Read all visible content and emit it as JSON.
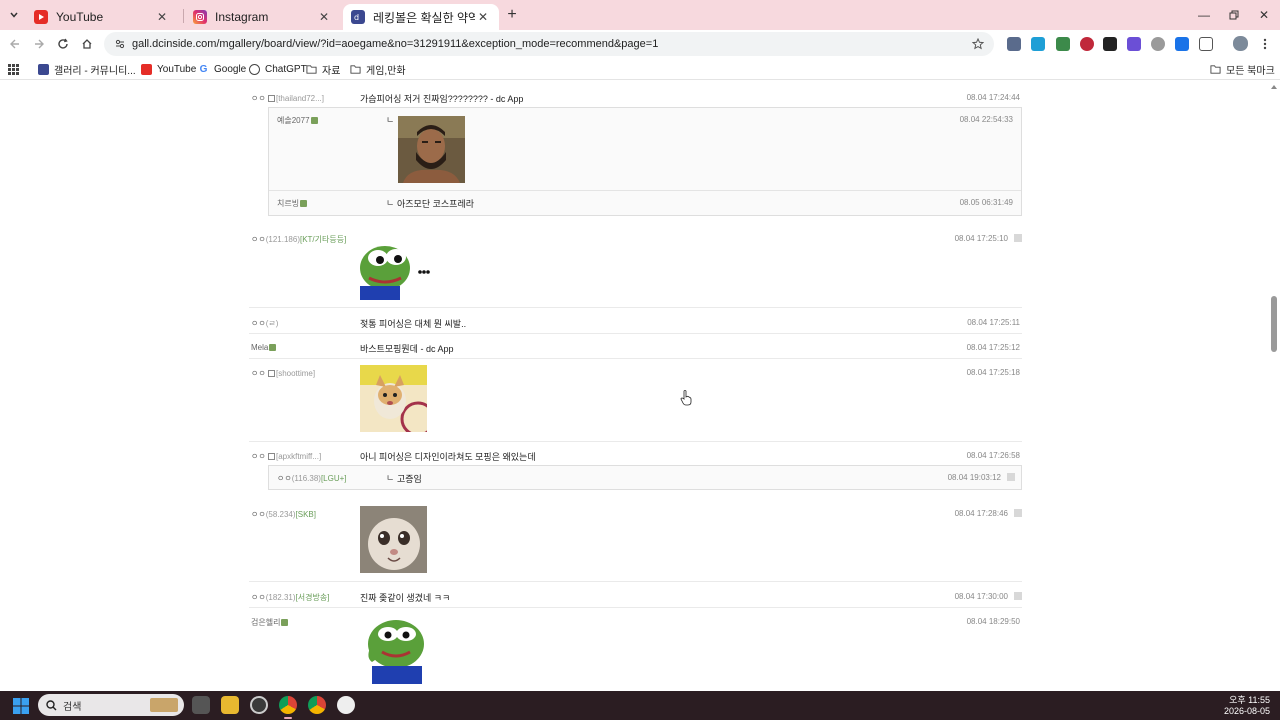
{
  "browser": {
    "tabs": [
      {
        "title": "YouTube",
        "icon": "youtube-icon",
        "active": false
      },
      {
        "title": "Instagram",
        "icon": "instagram-icon",
        "active": false
      },
      {
        "title": "레킹볼은 확실한 약역이우 - 준",
        "icon": "dcinside-icon",
        "active": true
      }
    ],
    "url": "gall.dcinside.com/mgallery/board/view/?id=aoegame&no=31291911&exception_mode=recommend&page=1",
    "bookmarks": [
      {
        "label": "갤러리 - 커뮤니티...",
        "icon": "dcinside-icon"
      },
      {
        "label": "YouTube",
        "icon": "youtube-icon"
      },
      {
        "label": "Google",
        "icon": "google-icon"
      },
      {
        "label": "ChatGPT",
        "icon": "chatgpt-icon"
      },
      {
        "label": "자료",
        "icon": "folder-icon"
      },
      {
        "label": "게임,만화",
        "icon": "folder-icon"
      }
    ],
    "bookmarks_right": "모든 북마크",
    "accent_color": "#f7d9de"
  },
  "comments": {
    "c1": {
      "nick": "ㅇㅇ",
      "ip": "[thailand72...]",
      "text": "가슴피어싱 저거 진짜임???????? - dc App",
      "date": "08.04 17:24:44"
    },
    "r1": {
      "nick": "예솔2077",
      "date": "08.04 22:54:33"
    },
    "r2": {
      "nick": "치르빙",
      "text": "아즈모단 코스프레라",
      "date": "08.05 06:31:49"
    },
    "c2": {
      "nick": "ㅇㅇ",
      "ip": "(121.186)",
      "ip2": "[KT/기타등등]",
      "date": "08.04 17:25:10"
    },
    "c3": {
      "nick": "ㅇㅇ",
      "ip": "(ㄹ)",
      "text": "젖통 피어싱은 대체 뭔 씨발..",
      "date": "08.04 17:25:11"
    },
    "c4": {
      "nick": "Mela",
      "text": "바스트모핑뭔데 - dc App",
      "date": "08.04 17:25:12"
    },
    "c5": {
      "nick": "ㅇㅇ",
      "ip": "[shoottime]",
      "date": "08.04 17:25:18"
    },
    "c6": {
      "nick": "ㅇㅇ",
      "ip": "[apxkftmiff...]",
      "text": "아니 피어싱은 디자인이라쳐도 모핑은 왜있는데",
      "date": "08.04 17:26:58"
    },
    "r3": {
      "nick": "ㅇㅇ",
      "ip": "(116.38)",
      "ip2": "[LGU+]",
      "text": "고증임",
      "date": "08.04 19:03:12"
    },
    "c7": {
      "nick": "ㅇㅇ",
      "ip": "(58.234)",
      "ip2": "[SKB]",
      "date": "08.04 17:28:46"
    },
    "c8": {
      "nick": "ㅇㅇ",
      "ip": "(182.31)",
      "ip2": "[서경방송]",
      "text": "진짜 좆같이 생겼네 ㅋㅋ",
      "date": "08.04 17:30:00"
    },
    "c9": {
      "nick": "검은헬리",
      "date": "08.04 18:29:50"
    }
  },
  "reply_mark": "ㄴ",
  "taskbar": {
    "search_label": "검색",
    "time": "오후 11:55",
    "date": "2026-08-05"
  }
}
